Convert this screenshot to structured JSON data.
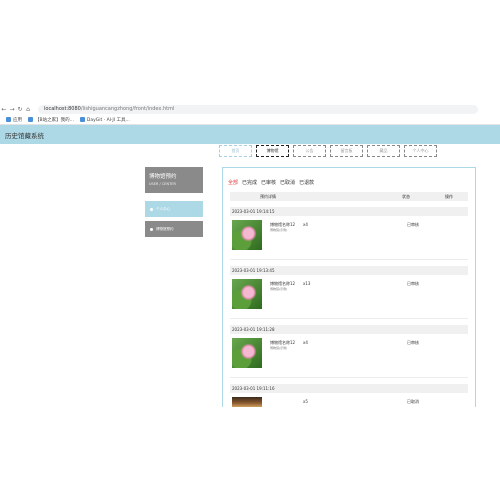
{
  "browser": {
    "nav_back": "←",
    "nav_forward": "→",
    "nav_reload": "↻",
    "nav_home": "⌂",
    "url_host": "localhost:8080",
    "url_path": "/lishiguancangzhong/front/index.html"
  },
  "bookmarks": [
    {
      "label": "应用"
    },
    {
      "label": "【B站之家】我的..."
    },
    {
      "label": "DayGit · AI·JI 工具..."
    }
  ],
  "app": {
    "title": "历史馆藏系统"
  },
  "topnav": [
    {
      "label": "首页",
      "state": "active"
    },
    {
      "label": "博物馆",
      "state": "normal"
    },
    {
      "label": "公告",
      "state": "dim"
    },
    {
      "label": "留言板",
      "state": "dim"
    },
    {
      "label": "藏品",
      "state": "dim"
    },
    {
      "label": "个人中心",
      "state": "dim"
    }
  ],
  "sidebar": {
    "title": "博物馆预约",
    "subtitle": "USER / CENTER",
    "items": [
      {
        "label": "个人中心"
      },
      {
        "label": "博物馆预约"
      }
    ]
  },
  "tabs": [
    {
      "label": "全部",
      "active": true
    },
    {
      "label": "已完成",
      "active": false
    },
    {
      "label": "已审核",
      "active": false
    },
    {
      "label": "已取消",
      "active": false
    },
    {
      "label": "已退款",
      "active": false
    }
  ],
  "columns": {
    "details": "预约详情",
    "status": "状态",
    "action": "操作"
  },
  "orders": [
    {
      "date": "2023-03-01 19:14:15",
      "name": "博物馆名称12",
      "sub": "博物馆(示例)",
      "qty": "x4",
      "status": "已审核"
    },
    {
      "date": "2023-03-01 19:13:45",
      "name": "博物馆名称12",
      "sub": "博物馆(示例)",
      "qty": "x13",
      "status": "已审核"
    },
    {
      "date": "2023-03-01 19:11:28",
      "name": "博物馆名称12",
      "sub": "博物馆(示例)",
      "qty": "x4",
      "status": "已审核"
    },
    {
      "date": "2023-03-01 19:11:16",
      "name": "",
      "sub": "",
      "qty": "x5",
      "status": "已取消"
    }
  ]
}
